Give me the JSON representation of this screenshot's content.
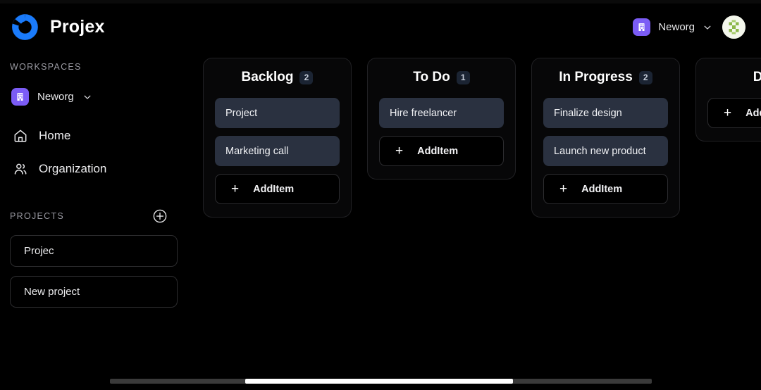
{
  "app": {
    "brand_name": "Projex",
    "logo_icon": "projex-ring-logo",
    "accent_blue": "#1a7bfb",
    "accent_purple": "#7b5cf5",
    "card_bg": "#2a3140",
    "page_bg": "#000000"
  },
  "header": {
    "org_name": "Neworg",
    "org_icon": "building-icon",
    "chevron_icon": "chevron-down-icon",
    "avatar_icon": "user-avatar"
  },
  "sidebar": {
    "workspaces_label": "WORKSPACES",
    "workspace": {
      "name": "Neworg",
      "icon": "building-icon",
      "chevron_icon": "chevron-down-icon"
    },
    "nav": [
      {
        "label": "Home",
        "icon": "home-icon"
      },
      {
        "label": "Organization",
        "icon": "users-icon"
      }
    ],
    "projects_label": "PROJECTS",
    "add_project_icon": "plus-circle-icon",
    "projects": [
      {
        "name": "Projec"
      },
      {
        "name": "New project"
      }
    ]
  },
  "board": {
    "add_item_label": "AddItem",
    "add_item_icon": "plus-icon",
    "columns": [
      {
        "title": "Backlog",
        "count": "2",
        "cards": [
          {
            "title": "Project"
          },
          {
            "title": "Marketing call"
          }
        ]
      },
      {
        "title": "To Do",
        "count": "1",
        "cards": [
          {
            "title": "Hire freelancer"
          }
        ]
      },
      {
        "title": "In Progress",
        "count": "2",
        "cards": [
          {
            "title": "Finalize design"
          },
          {
            "title": "Launch new product"
          }
        ]
      },
      {
        "title": "Done",
        "count": "",
        "cards": []
      }
    ]
  },
  "scrollbar": {
    "orientation": "horizontal"
  }
}
